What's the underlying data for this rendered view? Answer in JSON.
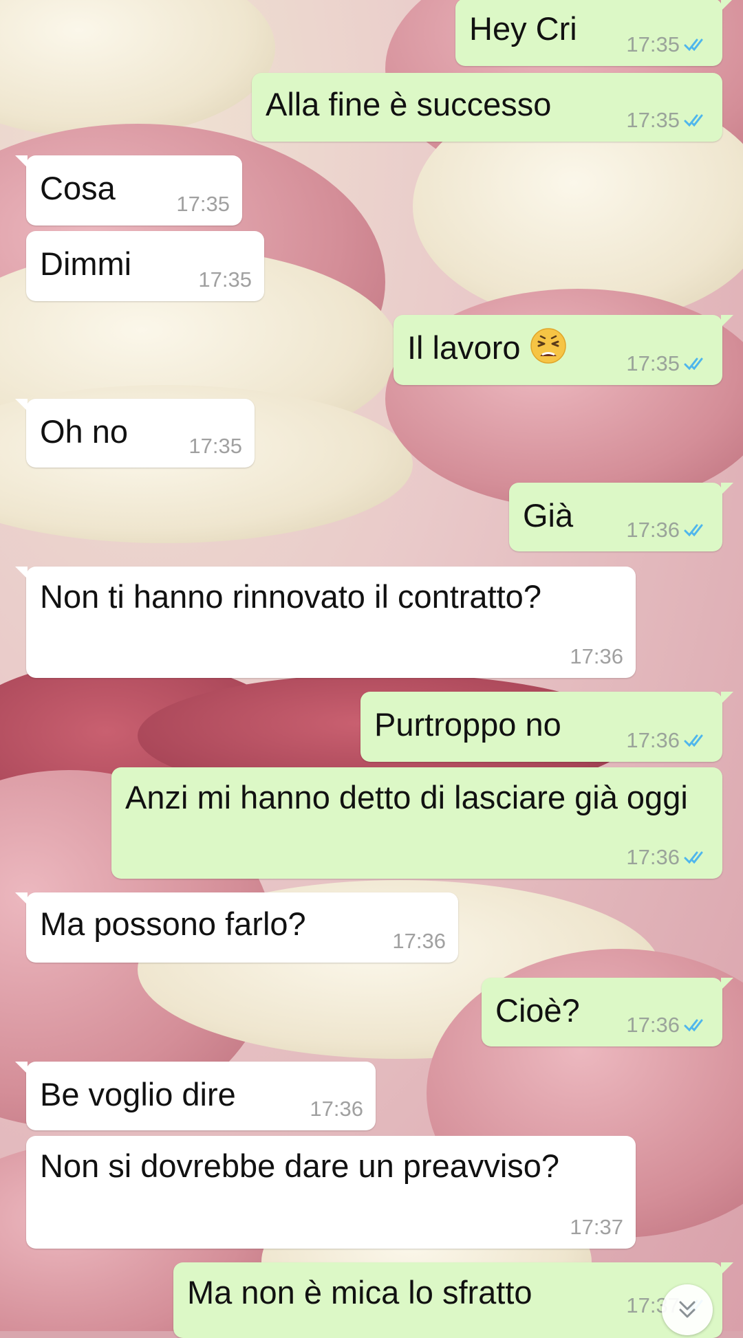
{
  "theme": {
    "outgoing_bubble": "#dcf8c6",
    "incoming_bubble": "#ffffff",
    "read_tick_color": "#4fb6ec"
  },
  "messages": [
    {
      "dir": "out",
      "text": "Hey Cri",
      "time": "17:35",
      "status": "read"
    },
    {
      "dir": "out",
      "text": "Alla fine è successo",
      "time": "17:35",
      "status": "read"
    },
    {
      "dir": "in",
      "text": "Cosa",
      "time": "17:35"
    },
    {
      "dir": "in",
      "text": "Dimmi",
      "time": "17:35"
    },
    {
      "dir": "out",
      "text": "Il lavoro",
      "emoji": "weary-face-emoji",
      "time": "17:35",
      "status": "read"
    },
    {
      "dir": "in",
      "text": "Oh no",
      "time": "17:35"
    },
    {
      "dir": "out",
      "text": "Già",
      "time": "17:36",
      "status": "read"
    },
    {
      "dir": "in",
      "text": "Non ti hanno rinnovato il contratto?",
      "time": "17:36"
    },
    {
      "dir": "out",
      "text": "Purtroppo no",
      "time": "17:36",
      "status": "read"
    },
    {
      "dir": "out",
      "text": "Anzi mi hanno detto di lasciare già oggi",
      "time": "17:36",
      "status": "read"
    },
    {
      "dir": "in",
      "text": "Ma possono farlo?",
      "time": "17:36"
    },
    {
      "dir": "out",
      "text": "Cioè?",
      "time": "17:36",
      "status": "read"
    },
    {
      "dir": "in",
      "text": "Be voglio dire",
      "time": "17:36"
    },
    {
      "dir": "in",
      "text": "Non si dovrebbe dare un preavviso?",
      "time": "17:37"
    },
    {
      "dir": "out",
      "text": "Ma non è mica lo sfratto",
      "time": "17:37",
      "status": "read"
    }
  ],
  "scroll_down_button": {
    "icon": "double-chevron-down-icon"
  }
}
